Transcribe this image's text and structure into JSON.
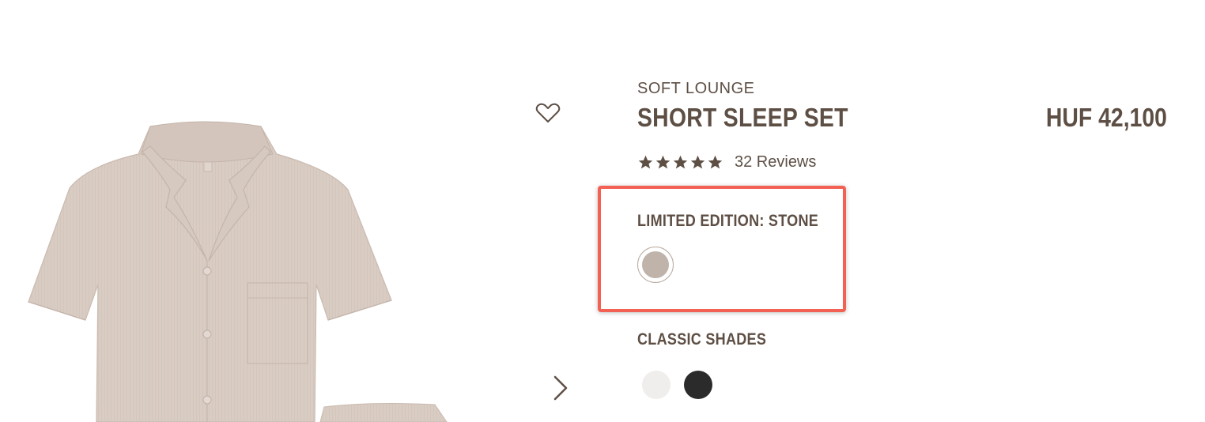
{
  "product": {
    "collection": "SOFT LOUNGE",
    "title": "SHORT SLEEP SET",
    "price": "HUF 42,100",
    "rating": 5,
    "reviews_text": "32 Reviews"
  },
  "limited_edition": {
    "label": "LIMITED EDITION: STONE",
    "swatches": [
      {
        "name": "Stone",
        "color": "#bfb3aa"
      }
    ]
  },
  "classic_shades": {
    "label": "CLASSIC SHADES",
    "swatches": [
      {
        "color": "#efeeec"
      },
      {
        "color": "#2b2b2c"
      }
    ]
  },
  "icons": {
    "wishlist": "heart-outline-icon",
    "next": "chevron-right-icon",
    "star": "star-filled-icon"
  },
  "colors": {
    "text": "#5e4f45",
    "highlight": "#f26153",
    "garment": "#d9ccc3"
  }
}
